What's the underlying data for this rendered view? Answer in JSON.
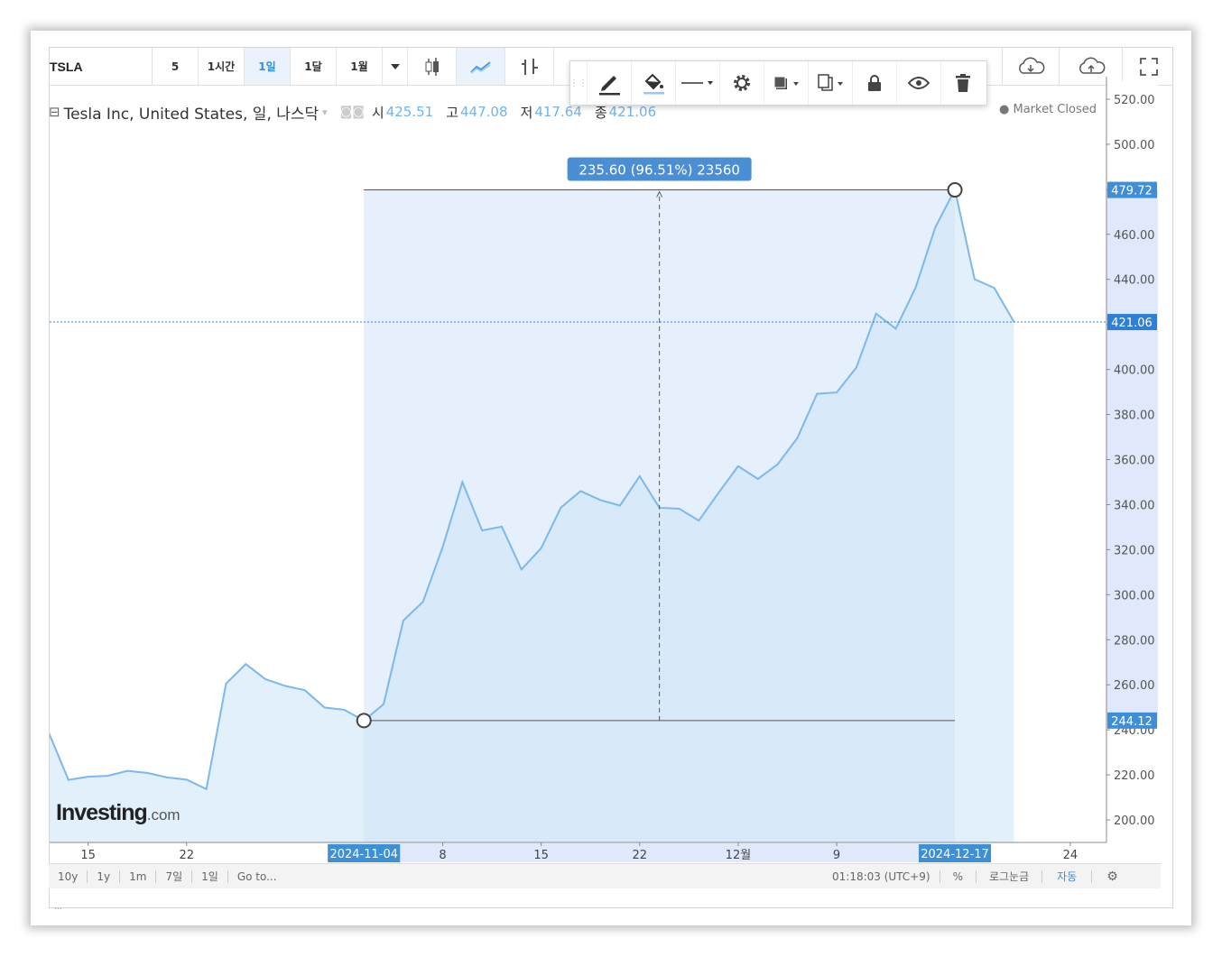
{
  "toolbar": {
    "symbol": "TSLA",
    "intervals": [
      "5",
      "1시간",
      "1일",
      "1달",
      "1월"
    ],
    "active_interval": "1일"
  },
  "legend": {
    "title": "Tesla Inc, United States, 일, 나스닥",
    "open_label": "시",
    "open": "425.51",
    "high_label": "고",
    "high": "447.08",
    "low_label": "저",
    "low": "417.64",
    "close_label": "종",
    "close": "421.06",
    "market_status": "Market Closed"
  },
  "measure": {
    "label": "235.60 (96.51%) 23560",
    "start_date": "2024-11-04",
    "end_date": "2024-12-17",
    "start_price": 244.12,
    "end_price": 479.72
  },
  "bottombar": {
    "ranges": [
      "10y",
      "1y",
      "1m",
      "7일",
      "1일",
      "Go to..."
    ],
    "time": "01:18:03 (UTC+9)",
    "percent": "%",
    "log": "로그눈금",
    "auto": "자동"
  },
  "logo": {
    "main": "Investing",
    "suffix": ".com"
  },
  "colors": {
    "line": "#7ab8ee",
    "area": "#e2f0fb",
    "measure_fill": "#cfe4f9",
    "axis_highlight": "#3d8fd8",
    "current_price": "#2f7fd6"
  },
  "chart_data": {
    "type": "area",
    "y_range": [
      190,
      526
    ],
    "y_ticks": [
      200,
      220,
      240,
      260,
      280,
      300,
      320,
      340,
      360,
      380,
      400,
      420,
      440,
      460,
      480,
      500,
      520
    ],
    "y_tick_labels": [
      "200.00",
      "220.00",
      "240.00",
      "260.00",
      "280.00",
      "300.00",
      "320.00",
      "340.00",
      "360.00",
      "380.00",
      "400.00",
      "420.00",
      "440.00",
      "460.00",
      "480.00",
      "500.00",
      "520.00"
    ],
    "x_tick_labels": [
      {
        "label": "15",
        "date": "2024-10-15"
      },
      {
        "label": "22",
        "date": "2024-10-22"
      },
      {
        "label": "8",
        "date": "2024-11-08"
      },
      {
        "label": "15",
        "date": "2024-11-15"
      },
      {
        "label": "22",
        "date": "2024-11-22"
      },
      {
        "label": "12월",
        "date": "2024-12-02"
      },
      {
        "label": "9",
        "date": "2024-12-09"
      },
      {
        "label": "24",
        "date": "2024-12-24"
      }
    ],
    "price_labels": [
      "479.72",
      "421.06",
      "244.12"
    ],
    "current_price": 421.06,
    "series": [
      {
        "x": [
          "2024-10-11",
          "2024-10-14",
          "2024-10-15",
          "2024-10-16",
          "2024-10-17",
          "2024-10-18",
          "2024-10-21",
          "2024-10-22",
          "2024-10-23",
          "2024-10-24",
          "2024-10-25",
          "2024-10-28",
          "2024-10-29",
          "2024-10-30",
          "2024-10-31",
          "2024-11-01",
          "2024-11-04",
          "2024-11-05",
          "2024-11-06",
          "2024-11-07",
          "2024-11-08",
          "2024-11-11",
          "2024-11-12",
          "2024-11-13",
          "2024-11-14",
          "2024-11-15",
          "2024-11-18",
          "2024-11-19",
          "2024-11-20",
          "2024-11-21",
          "2024-11-22",
          "2024-11-25",
          "2024-11-26",
          "2024-11-27",
          "2024-11-29",
          "2024-12-02",
          "2024-12-03",
          "2024-12-04",
          "2024-12-05",
          "2024-12-06",
          "2024-12-09",
          "2024-12-10",
          "2024-12-11",
          "2024-12-12",
          "2024-12-13",
          "2024-12-16",
          "2024-12-17",
          "2024-12-18",
          "2024-12-19",
          "2024-12-20"
        ],
        "values": [
          238.8,
          217.8,
          219.2,
          219.6,
          221.8,
          220.9,
          218.9,
          217.9,
          213.7,
          260.5,
          269.2,
          262.5,
          259.5,
          257.6,
          249.9,
          248.9,
          244.1,
          251.4,
          288.5,
          296.9,
          321.2,
          350.0,
          328.5,
          330.2,
          311.2,
          320.7,
          338.7,
          346.0,
          342.0,
          339.6,
          352.6,
          338.6,
          338.2,
          332.9,
          345.2,
          357.1,
          351.4,
          357.9,
          369.5,
          389.2,
          389.8,
          400.9,
          424.8,
          418.1,
          436.2,
          463.0,
          479.9,
          440.1,
          436.2,
          421.1
        ]
      }
    ]
  }
}
